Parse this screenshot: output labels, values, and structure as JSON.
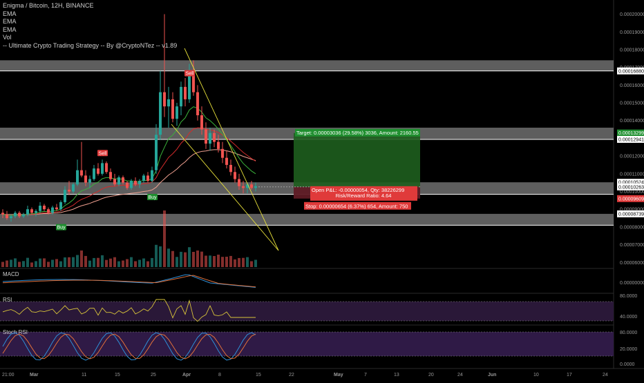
{
  "legend": {
    "symbol": "Enigma / Bitcoin, 12H, BINANCE",
    "ema1": "EMA",
    "ema2": "EMA",
    "ema3": "EMA",
    "vol": "Vol",
    "strategy": "-- Ultimate Crypto Trading Strategy -- By @CryptoNTez -- v1.89"
  },
  "colors": {
    "background": "#000000",
    "up": "#26a69a",
    "down": "#ef5350",
    "ema_green": "#3bb33b",
    "ema_red": "#d22b2b",
    "ema_salmon": "#f0a090",
    "wedge": "#e8e13a",
    "target_fill": "#1e5e1e",
    "stop_fill": "#5e1a24",
    "macd_blue": "#2f8fd6",
    "macd_orange": "#e0703a",
    "rsi_line": "#d8c43a",
    "rsi_band": "#2a1838",
    "stoch_band": "#2f1a46",
    "stoch_k": "#2f8fd6",
    "stoch_d": "#e0703a",
    "tag_red": "#e03a3a",
    "tag_green": "#1f8f2f"
  },
  "chart_data": {
    "type": "candlestick",
    "price_axis": {
      "ylim": [
        5.7e-06,
        2.08e-05
      ],
      "ticks": [
        "0.00020000",
        "0.00019000",
        "0.00018000",
        "0.00017000",
        "0.00016000",
        "0.00015000",
        "0.00014000",
        "0.00013000",
        "0.00012000",
        "0.00011000",
        "0.00010000",
        "0.00009000",
        "0.00008000",
        "0.00007000",
        "0.00006000"
      ],
      "tick_values": [
        2e-05,
        1.9e-05,
        1.8e-05,
        1.7e-05,
        1.6e-05,
        1.5e-05,
        1.4e-05,
        1.3e-05,
        1.2e-05,
        1.1e-05,
        1e-05,
        9e-06,
        8e-06,
        7e-06,
        6e-06
      ]
    },
    "x_axis": {
      "ticks": [
        "21:00",
        "Mar",
        "11",
        "15",
        "25",
        "Apr",
        "8",
        "15",
        "22",
        "May",
        "7",
        "13",
        "20",
        "24",
        "Jun",
        "10",
        "17",
        "24"
      ]
    },
    "price_tags": [
      {
        "label": "0.00016880",
        "value": 1.68e-05,
        "style": "white"
      },
      {
        "label": "0.00013299",
        "value": 1.33e-05,
        "style": "green"
      },
      {
        "label": "0.00012941",
        "value": 1.294e-05,
        "style": "white"
      },
      {
        "label": "0.00010524",
        "value": 1.052e-05,
        "style": "white"
      },
      {
        "label": "0.00010263",
        "value": 1.026e-05,
        "style": "white"
      },
      {
        "label": "0.00009609",
        "value": 9.6e-06,
        "style": "red"
      },
      {
        "label": "0.00008739",
        "value": 8.74e-06,
        "style": "white"
      }
    ],
    "support_resistance_zones": [
      {
        "from": 1.68e-05,
        "to": 1.74e-05
      },
      {
        "from": 1.294e-05,
        "to": 1.36e-05
      },
      {
        "from": 9.84e-06,
        "to": 1.052e-05
      },
      {
        "from": 8.1e-06,
        "to": 8.74e-06
      }
    ],
    "signals": [
      {
        "label": "Buy",
        "type": "buy",
        "x_index": 14,
        "price": 8.4e-06
      },
      {
        "label": "Sell",
        "type": "sell",
        "x_index": 24,
        "price": 1.18e-05
      },
      {
        "label": "Buy",
        "type": "buy",
        "x_index": 36,
        "price": 1.01e-05
      },
      {
        "label": "Sell",
        "type": "sell",
        "x_index": 45,
        "price": 1.63e-05
      }
    ],
    "position": {
      "target_label": "Target: 0.00003036 (29.58%) 3036, Amount: 2160.55",
      "open_pl_label": "Open P&L: -0.00000054, Qty: 38226299",
      "rr_label": "Risk/Reward Ratio: 4.64",
      "stop_label": "Stop: 0.00000654 (6.37%) 654, Amount: 750",
      "entry": 1.026e-05,
      "target": 1.33e-05,
      "stop": 9.6e-06
    },
    "candles": [
      [
        8.8,
        9.0,
        8.5,
        8.7
      ],
      [
        8.7,
        8.9,
        8.4,
        8.5
      ],
      [
        8.5,
        8.7,
        8.3,
        8.6
      ],
      [
        8.6,
        8.9,
        8.5,
        8.8
      ],
      [
        8.8,
        8.9,
        8.5,
        8.6
      ],
      [
        8.6,
        8.8,
        8.5,
        8.7
      ],
      [
        8.7,
        9.2,
        8.6,
        9.0
      ],
      [
        9.0,
        9.1,
        8.7,
        8.8
      ],
      [
        8.8,
        9.0,
        8.6,
        8.9
      ],
      [
        8.9,
        9.4,
        8.8,
        9.2
      ],
      [
        9.2,
        9.3,
        8.9,
        9.0
      ],
      [
        9.0,
        9.1,
        8.7,
        8.8
      ],
      [
        8.8,
        9.2,
        8.7,
        9.1
      ],
      [
        9.1,
        9.3,
        8.9,
        9.0
      ],
      [
        9.0,
        9.5,
        8.9,
        9.4
      ],
      [
        9.4,
        10.3,
        9.3,
        10.1
      ],
      [
        10.1,
        10.6,
        9.8,
        10.0
      ],
      [
        10.0,
        10.5,
        9.9,
        10.4
      ],
      [
        10.4,
        11.8,
        10.3,
        11.2
      ],
      [
        11.2,
        12.8,
        10.8,
        10.9
      ],
      [
        10.9,
        11.2,
        10.3,
        10.5
      ],
      [
        10.5,
        10.9,
        10.2,
        10.7
      ],
      [
        10.7,
        11.5,
        10.6,
        11.3
      ],
      [
        11.3,
        11.6,
        10.9,
        11.0
      ],
      [
        11.0,
        11.8,
        10.9,
        11.6
      ],
      [
        11.6,
        11.7,
        11.0,
        11.1
      ],
      [
        11.1,
        11.3,
        10.6,
        10.7
      ],
      [
        10.7,
        11.0,
        10.3,
        10.4
      ],
      [
        10.4,
        10.9,
        10.3,
        10.8
      ],
      [
        10.8,
        10.9,
        10.4,
        10.5
      ],
      [
        10.5,
        10.6,
        10.1,
        10.2
      ],
      [
        10.2,
        10.7,
        10.1,
        10.6
      ],
      [
        10.6,
        10.8,
        10.3,
        10.4
      ],
      [
        10.4,
        10.7,
        10.2,
        10.6
      ],
      [
        10.6,
        11.0,
        10.5,
        10.9
      ],
      [
        10.9,
        11.1,
        10.5,
        10.6
      ],
      [
        10.6,
        11.4,
        10.5,
        11.2
      ],
      [
        11.2,
        13.8,
        11.0,
        13.2
      ],
      [
        13.2,
        16.8,
        12.9,
        15.6
      ],
      [
        15.6,
        20.0,
        14.2,
        14.8
      ],
      [
        14.8,
        15.9,
        13.6,
        15.2
      ],
      [
        15.2,
        15.6,
        13.9,
        14.1
      ],
      [
        14.1,
        15.0,
        13.7,
        14.8
      ],
      [
        14.8,
        16.2,
        14.3,
        15.9
      ],
      [
        15.9,
        16.4,
        14.8,
        15.2
      ],
      [
        15.2,
        17.2,
        15.0,
        16.6
      ],
      [
        16.6,
        17.4,
        15.4,
        15.6
      ],
      [
        15.6,
        16.0,
        14.0,
        14.3
      ],
      [
        14.3,
        14.8,
        13.2,
        13.5
      ],
      [
        13.5,
        13.9,
        12.4,
        12.7
      ],
      [
        12.7,
        13.6,
        12.3,
        13.3
      ],
      [
        13.3,
        13.5,
        12.5,
        12.8
      ],
      [
        12.8,
        13.2,
        12.2,
        12.4
      ],
      [
        12.4,
        12.8,
        11.6,
        11.9
      ],
      [
        11.9,
        12.3,
        11.3,
        11.5
      ],
      [
        11.5,
        11.8,
        10.9,
        11.1
      ],
      [
        11.1,
        11.4,
        10.5,
        10.7
      ],
      [
        10.7,
        11.0,
        10.1,
        10.3
      ],
      [
        10.3,
        10.6,
        9.9,
        10.2
      ],
      [
        10.2,
        10.5,
        9.9,
        10.4
      ],
      [
        10.4,
        10.6,
        10.1,
        10.2
      ],
      [
        10.2,
        10.5,
        10.0,
        10.3
      ]
    ]
  }
}
